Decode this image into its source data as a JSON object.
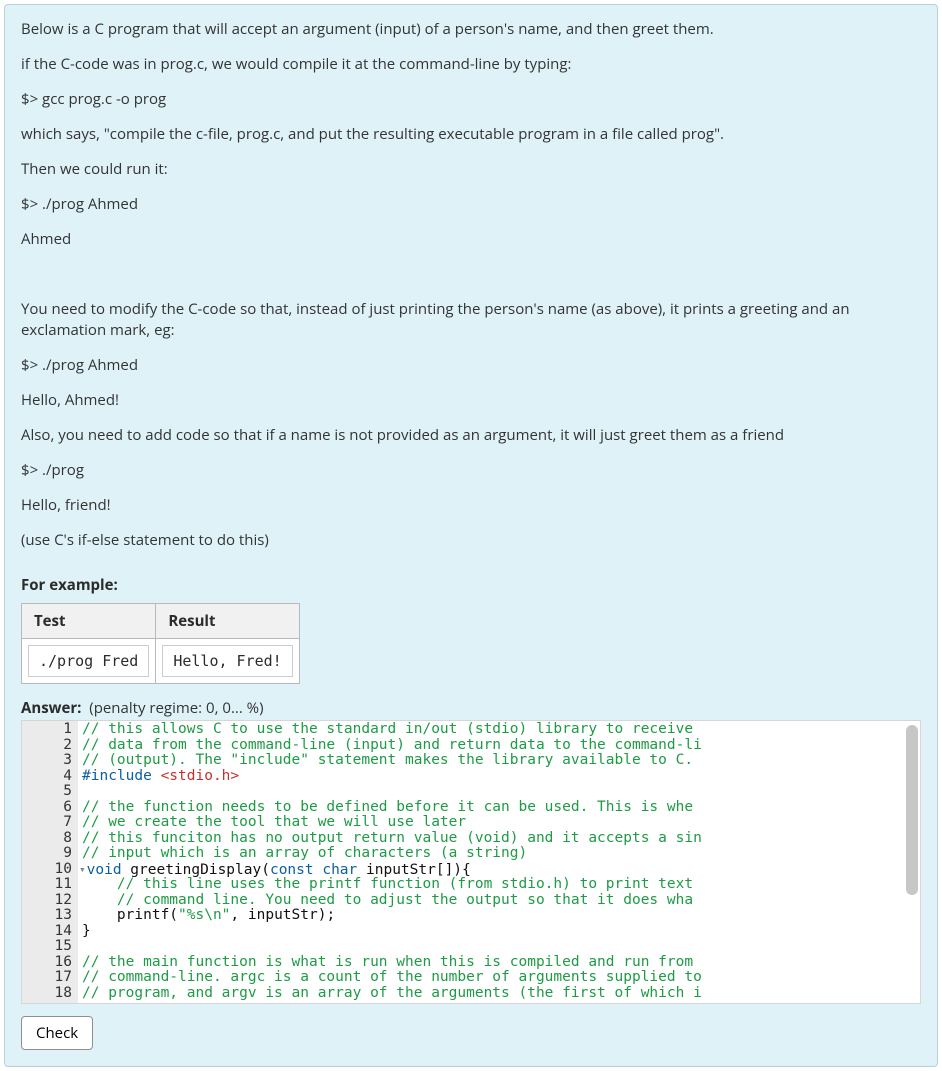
{
  "qtext": {
    "p1": "Below is a C program that will accept an argument (input) of a person's name, and then greet them.",
    "p2": "if the C-code was in prog.c, we would compile it at the command-line by typing:",
    "p3": "$> gcc prog.c -o prog",
    "p4": "which says, \"compile the c-file, prog.c, and put the resulting executable program in a file called prog\".",
    "p5": "Then we could run it:",
    "p6": "$> ./prog Ahmed",
    "p7": "Ahmed",
    "p8": " ",
    "p9": "You need to modify the C-code so that, instead of just printing the person's name (as above), it prints a greeting and an exclamation mark, eg:",
    "p10": "$> ./prog Ahmed",
    "p11": "Hello, Ahmed!",
    "p12": "Also, you need to add code so that if a name is not provided as an argument, it will just greet them as a friend",
    "p13": "$> ./prog",
    "p14": "Hello, friend!",
    "p15": "(use C's if-else statement to do this)"
  },
  "example": {
    "heading": "For example:",
    "headers": {
      "test": "Test",
      "result": "Result"
    },
    "rows": [
      {
        "test": "./prog Fred",
        "result": "Hello, Fred!"
      }
    ]
  },
  "answer": {
    "label": "Answer:",
    "penalty": "(penalty regime: 0, 0... %)"
  },
  "editor": {
    "line_count": 18,
    "lines": [
      {
        "n": 1,
        "segments": [
          {
            "cls": "tok-comment",
            "t": "// this allows C to use the standard in/out (stdio) library to receive"
          }
        ]
      },
      {
        "n": 2,
        "segments": [
          {
            "cls": "tok-comment",
            "t": "// data from the command-line (input) and return data to the command-li"
          }
        ]
      },
      {
        "n": 3,
        "segments": [
          {
            "cls": "tok-comment",
            "t": "// (output). The \"include\" statement makes the library available to C."
          }
        ]
      },
      {
        "n": 4,
        "segments": [
          {
            "cls": "tok-preproc",
            "t": "#include "
          },
          {
            "cls": "tok-include",
            "t": "<stdio.h>"
          }
        ]
      },
      {
        "n": 5,
        "segments": [
          {
            "cls": "",
            "t": ""
          }
        ]
      },
      {
        "n": 6,
        "segments": [
          {
            "cls": "tok-comment",
            "t": "// the function needs to be defined before it can be used. This is whe"
          }
        ]
      },
      {
        "n": 7,
        "segments": [
          {
            "cls": "tok-comment",
            "t": "// we create the tool that we will use later"
          }
        ]
      },
      {
        "n": 8,
        "segments": [
          {
            "cls": "tok-comment",
            "t": "// this funciton has no output return value (void) and it accepts a sin"
          }
        ]
      },
      {
        "n": 9,
        "segments": [
          {
            "cls": "tok-comment",
            "t": "// input which is an array of characters (a string)"
          }
        ]
      },
      {
        "n": 10,
        "fold": true,
        "segments": [
          {
            "cls": "tok-keyword",
            "t": "void "
          },
          {
            "cls": "tok-ident",
            "t": "greetingDisplay("
          },
          {
            "cls": "tok-keyword",
            "t": "const char "
          },
          {
            "cls": "tok-ident",
            "t": "inputStr[]){"
          }
        ]
      },
      {
        "n": 11,
        "segments": [
          {
            "cls": "tok-comment",
            "t": "    // this line uses the printf function (from stdio.h) to print text"
          }
        ]
      },
      {
        "n": 12,
        "segments": [
          {
            "cls": "tok-comment",
            "t": "    // command line. You need to adjust the output so that it does wha"
          }
        ]
      },
      {
        "n": 13,
        "segments": [
          {
            "cls": "tok-ident",
            "t": "    printf("
          },
          {
            "cls": "tok-string",
            "t": "\"%s\\n\""
          },
          {
            "cls": "tok-ident",
            "t": ", inputStr);"
          }
        ]
      },
      {
        "n": 14,
        "segments": [
          {
            "cls": "tok-ident",
            "t": "}"
          }
        ]
      },
      {
        "n": 15,
        "segments": [
          {
            "cls": "",
            "t": ""
          }
        ]
      },
      {
        "n": 16,
        "segments": [
          {
            "cls": "tok-comment",
            "t": "// the main function is what is run when this is compiled and run from"
          }
        ]
      },
      {
        "n": 17,
        "segments": [
          {
            "cls": "tok-comment",
            "t": "// command-line. argc is a count of the number of arguments supplied to"
          }
        ]
      },
      {
        "n": 18,
        "segments": [
          {
            "cls": "tok-comment",
            "t": "// program, and argv is an array of the arguments (the first of which i"
          }
        ]
      }
    ]
  },
  "buttons": {
    "check": "Check"
  }
}
